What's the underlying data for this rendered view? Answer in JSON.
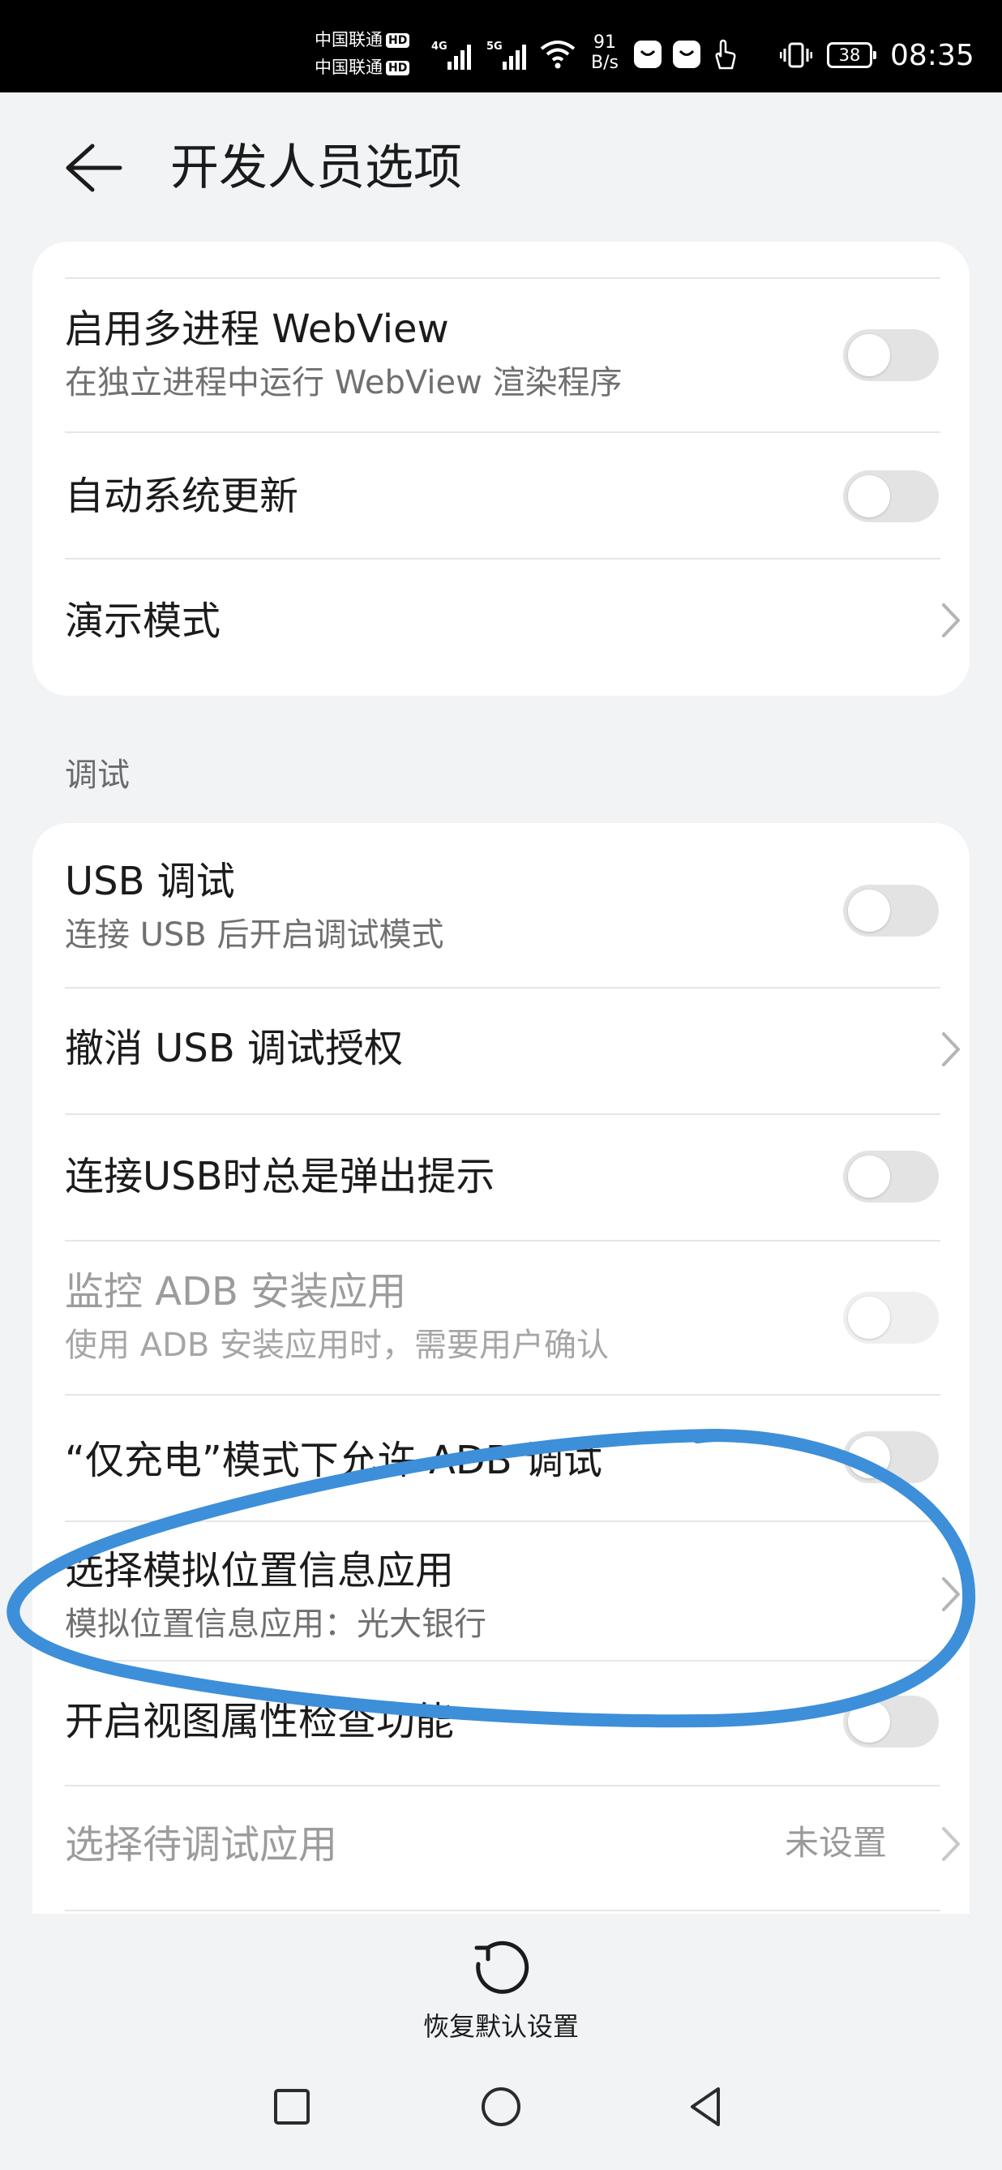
{
  "status_bar": {
    "carrier1": "中国联通",
    "carrier2": "中国联通",
    "hd_label": "HD",
    "net1": "4G",
    "net2": "5G",
    "speed_value": "91",
    "speed_unit": "B/s",
    "battery": "38",
    "time": "08:35"
  },
  "header": {
    "title": "开发人员选项"
  },
  "card1": {
    "items": [
      {
        "title": "启用多进程 WebView",
        "subtitle": "在独立进程中运行 WebView 渲染程序",
        "control": "toggle",
        "on": false
      },
      {
        "title": "自动系统更新",
        "control": "toggle",
        "on": false
      },
      {
        "title": "演示模式",
        "control": "chevron"
      }
    ]
  },
  "section": {
    "label": "调试"
  },
  "card2": {
    "items": [
      {
        "title": "USB 调试",
        "subtitle": "连接 USB 后开启调试模式",
        "control": "toggle",
        "on": false
      },
      {
        "title": "撤消 USB 调试授权",
        "control": "chevron"
      },
      {
        "title": "连接USB时总是弹出提示",
        "control": "toggle",
        "on": false
      },
      {
        "title": "监控 ADB 安装应用",
        "subtitle": "使用 ADB 安装应用时，需要用户确认",
        "control": "toggle",
        "on": false,
        "disabled": true
      },
      {
        "title": "“仅充电”模式下允许 ADB 调试",
        "control": "toggle",
        "on": false
      },
      {
        "title": "选择模拟位置信息应用",
        "subtitle": "模拟位置信息应用：光大银行",
        "control": "chevron"
      },
      {
        "title": "开启视图属性检查功能",
        "control": "toggle",
        "on": false
      },
      {
        "title": "选择待调试应用",
        "value": "未设置",
        "control": "chevron",
        "disabled": true
      }
    ]
  },
  "bottom": {
    "restore_label": "恢复默认设置"
  },
  "colors": {
    "background": "#f1f3f5",
    "card": "#ffffff",
    "annotation_stroke": "#3d8fd9"
  }
}
